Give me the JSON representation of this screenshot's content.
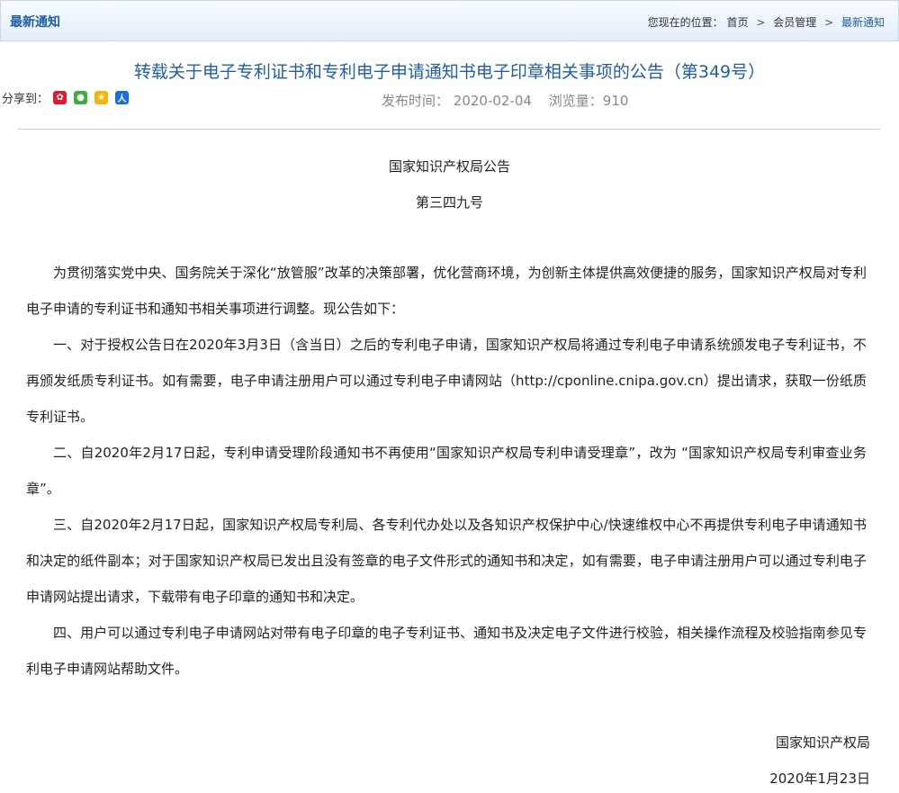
{
  "header": {
    "title": "最新通知",
    "location_label": "您现在的位置：",
    "breadcrumb": [
      "首页",
      "会员管理",
      "最新通知"
    ],
    "separator": ">"
  },
  "article": {
    "title": "转载关于电子专利证书和专利电子申请通知书电子印章相关事项的公告（第349号）",
    "share_label": "分享到：",
    "publish_label": "发布时间：",
    "publish_date": "2020-02-04",
    "views_label": "浏览量：",
    "views": "910",
    "issuer": "国家知识产权局公告",
    "number": "第三四九号",
    "paragraphs": [
      "为贯彻落实党中央、国务院关于深化“放管服”改革的决策部署，优化营商环境，为创新主体提供高效便捷的服务，国家知识产权局对专利电子申请的专利证书和通知书相关事项进行调整。现公告如下：",
      "一、对于授权公告日在2020年3月3日（含当日）之后的专利电子申请，国家知识产权局将通过专利电子申请系统颁发电子专利证书，不再颁发纸质专利证书。如有需要，电子申请注册用户可以通过专利电子申请网站（http://cponline.cnipa.gov.cn）提出请求，获取一份纸质专利证书。",
      "二、自2020年2月17日起，专利申请受理阶段通知书不再使用“国家知识产权局专利申请受理章”，改为 “国家知识产权局专利审查业务章”。",
      "三、自2020年2月17日起，国家知识产权局专利局、各专利代办处以及各知识产权保护中心/快速维权中心不再提供专利电子申请通知书和决定的纸件副本；对于国家知识产权局已发出且没有签章的电子文件形式的通知书和决定，如有需要，电子申请注册用户可以通过专利电子申请网站提出请求，下载带有电子印章的通知书和决定。",
      "四、用户可以通过专利电子申请网站对带有电子印章的电子专利证书、通知书及决定电子文件进行校验，相关操作流程及校验指南参见专利电子申请网站帮助文件。"
    ],
    "signature": "国家知识产权局",
    "sign_date": "2020年1月23日"
  }
}
